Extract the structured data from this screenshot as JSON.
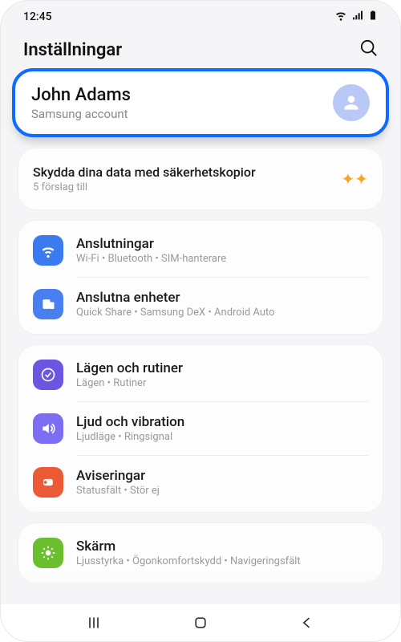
{
  "status": {
    "time": "12:45"
  },
  "header": {
    "title": "Inställningar"
  },
  "account": {
    "name": "John Adams",
    "sub": "Samsung account"
  },
  "suggestion": {
    "title": "Skydda dina data med säkerhetskopior",
    "sub": "5 förslag till"
  },
  "groups": [
    {
      "items": [
        {
          "icon": "wifi",
          "color": "bg-blue",
          "title": "Anslutningar",
          "sub": "Wi-Fi  •  Bluetooth  •  SIM-hanterare"
        },
        {
          "icon": "devices",
          "color": "bg-blue2",
          "title": "Anslutna enheter",
          "sub": "Quick Share  •  Samsung DeX  •  Android Auto"
        }
      ]
    },
    {
      "items": [
        {
          "icon": "check-circle",
          "color": "bg-purple",
          "title": "Lägen och rutiner",
          "sub": "Lägen  •  Rutiner"
        },
        {
          "icon": "volume",
          "color": "bg-violet",
          "title": "Ljud och vibration",
          "sub": "Ljudläge  •  Ringsignal"
        },
        {
          "icon": "bell",
          "color": "bg-orange",
          "title": "Aviseringar",
          "sub": "Statusfält  •  Stör ej"
        }
      ]
    },
    {
      "items": [
        {
          "icon": "sun",
          "color": "bg-green",
          "title": "Skärm",
          "sub": "Ljusstyrka  •  Ögonkomfortskydd  •  Navigeringsfält"
        }
      ]
    }
  ]
}
